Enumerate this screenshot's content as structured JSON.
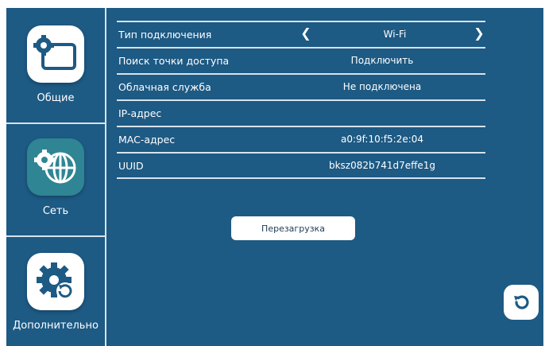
{
  "sidebar": {
    "items": [
      {
        "label": "Общие",
        "icon": "settings-window-icon"
      },
      {
        "label": "Сеть",
        "icon": "network-globe-icon"
      },
      {
        "label": "Дополнительно",
        "icon": "advanced-gear-icon"
      }
    ],
    "active_index": 1
  },
  "settings": {
    "connection_type": {
      "label": "Тип подключения",
      "value": "Wi-Fi",
      "prev_icon": "chevron-left-icon",
      "next_icon": "chevron-right-icon"
    },
    "access_point": {
      "label": "Поиск точки доступа",
      "value": "Подключить"
    },
    "cloud": {
      "label": "Облачная служба",
      "value": "Не подключена"
    },
    "ip": {
      "label": "IP-адрес",
      "value": ""
    },
    "mac": {
      "label": "MAC-адрес",
      "value": "a0:9f:10:f5:2e:04"
    },
    "uuid": {
      "label": "UUID",
      "value": "bksz082b741d7effe1g"
    }
  },
  "reboot_button": {
    "label": "Перезагрузка"
  },
  "back_button": {
    "icon": "undo-icon"
  },
  "colors": {
    "background": "#1d5a84",
    "divider": "#d7e3ec",
    "active_tile": "#2f8593",
    "tile": "#ffffff"
  }
}
